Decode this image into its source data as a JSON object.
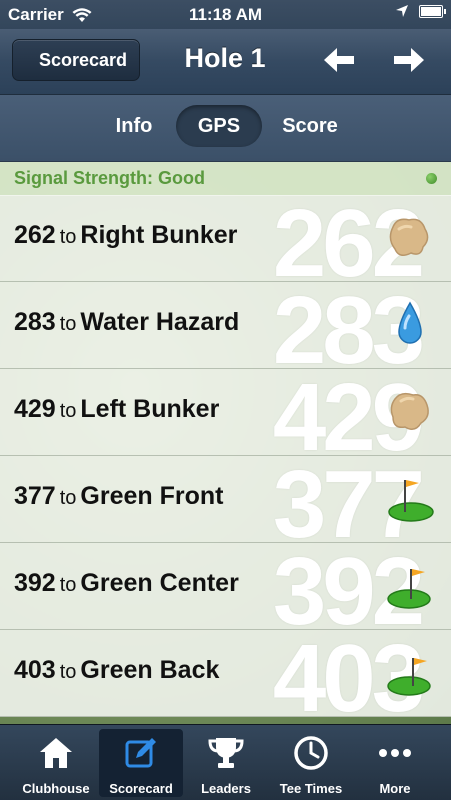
{
  "status": {
    "carrier": "Carrier",
    "time": "11:18 AM"
  },
  "nav": {
    "back_label": "Scorecard",
    "title": "Hole 1"
  },
  "segments": [
    {
      "label": "Info",
      "active": false
    },
    {
      "label": "GPS",
      "active": true
    },
    {
      "label": "Score",
      "active": false
    }
  ],
  "signal": {
    "text": "Signal Strength: Good",
    "color": "#5a9a3e"
  },
  "targets": [
    {
      "distance": "262",
      "to": "to",
      "name": "Right Bunker",
      "big": "262",
      "icon": "bunker-icon"
    },
    {
      "distance": "283",
      "to": "to",
      "name": "Water Hazard",
      "big": "283",
      "icon": "water-drop-icon"
    },
    {
      "distance": "429",
      "to": "to",
      "name": "Left Bunker",
      "big": "429",
      "icon": "bunker-icon"
    },
    {
      "distance": "377",
      "to": "to",
      "name": "Green Front",
      "big": "377",
      "icon": "green-flag-icon"
    },
    {
      "distance": "392",
      "to": "to",
      "name": "Green Center",
      "big": "392",
      "icon": "green-flag-icon"
    },
    {
      "distance": "403",
      "to": "to",
      "name": "Green Back",
      "big": "403",
      "icon": "green-flag-icon"
    }
  ],
  "tabs": [
    {
      "label": "Clubhouse",
      "icon": "house-icon",
      "active": false
    },
    {
      "label": "Scorecard",
      "icon": "scorecard-edit-icon",
      "active": true
    },
    {
      "label": "Leaders",
      "icon": "trophy-icon",
      "active": false
    },
    {
      "label": "Tee Times",
      "icon": "clock-icon",
      "active": false
    },
    {
      "label": "More",
      "icon": "more-dots-icon",
      "active": false
    }
  ]
}
